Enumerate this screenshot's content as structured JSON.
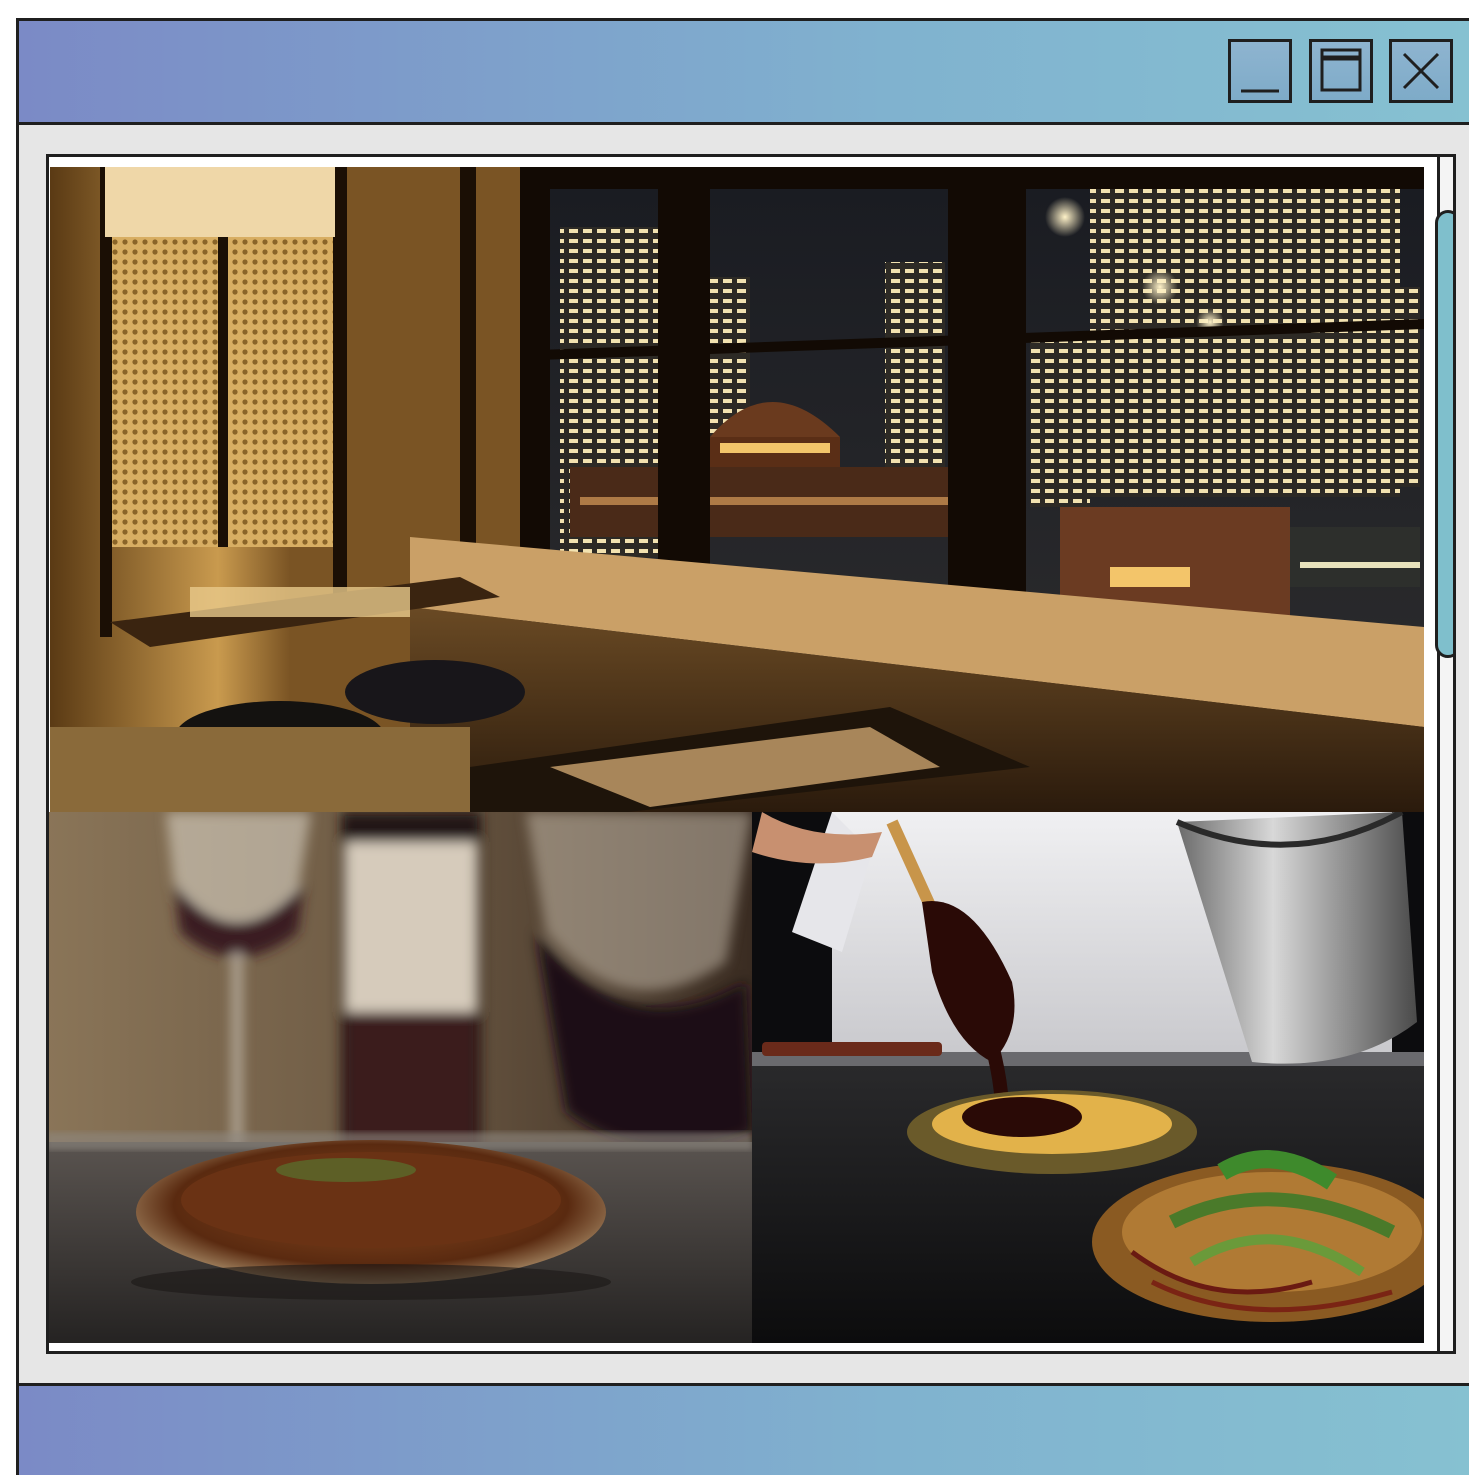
{
  "window": {
    "controls": {
      "minimize_icon": "minimize-icon",
      "maximize_icon": "maximize-icon",
      "close_icon": "close-icon"
    },
    "theme": {
      "bar_gradient_start": "#7b8ac6",
      "bar_gradient_end": "#86c1d1",
      "scroll_thumb": "#7fbfcc"
    }
  },
  "gallery": {
    "images": [
      {
        "name": "restaurant-interior-night-view"
      },
      {
        "name": "okonomiyaki-with-red-wine"
      },
      {
        "name": "chef-saucing-okonomiyaki-and-yakisoba"
      }
    ]
  },
  "scroll": {
    "position_fraction": 0.0,
    "thumb_fraction": 0.4
  }
}
